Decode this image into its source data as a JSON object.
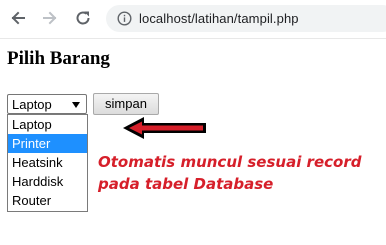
{
  "browser": {
    "url": "localhost/latihan/tampil.php",
    "icons": {
      "back": "arrow-left-icon",
      "forward": "arrow-right-icon",
      "reload": "reload-icon",
      "site_info": "info-icon"
    }
  },
  "page": {
    "title": "Pilih Barang"
  },
  "form": {
    "select_value": "Laptop",
    "save_label": "simpan",
    "options": [
      "Laptop",
      "Printer",
      "Heatsink",
      "Harddisk",
      "Router"
    ],
    "highlighted_option": "Printer"
  },
  "annotation": {
    "line1": "Otomatis muncul sesuai record",
    "line2": "pada tabel Database",
    "color": "#d61f2a"
  },
  "colors": {
    "highlight": "#1e90ff",
    "annotation_red": "#d61f2a"
  }
}
